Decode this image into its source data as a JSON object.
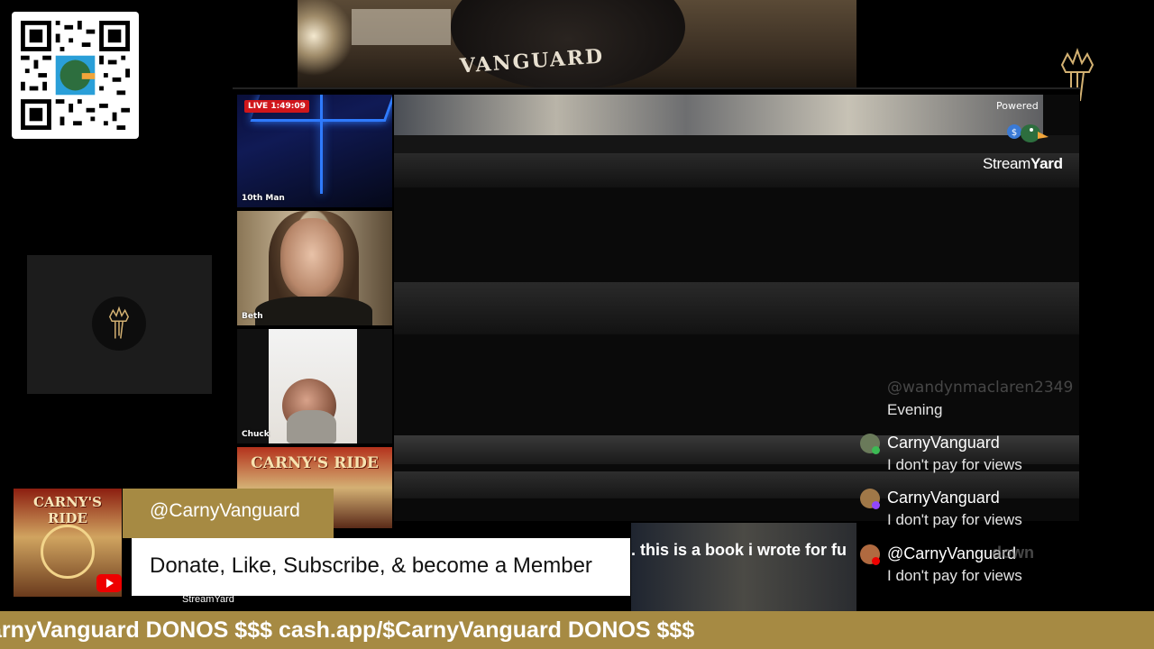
{
  "background": {
    "patch_text": "VANGUARD"
  },
  "stream": {
    "live_badge": "LIVE 1:49:09",
    "participants": [
      {
        "name": "10th Man"
      },
      {
        "name": "Beth"
      },
      {
        "name": "Chuck"
      }
    ],
    "banner_title": "CARNY'S RIDE"
  },
  "branding": {
    "powered_label": "Powered",
    "streamyard_prefix": "Stream",
    "streamyard_suffix": "Yard",
    "streamyard_small": "StreamYard",
    "lower_third_logo": "CARNY'S RIDE"
  },
  "chat": {
    "faded_user": "@wandynmaclaren2349",
    "messages": [
      {
        "name": "",
        "text": "Evening"
      },
      {
        "name": "CarnyVanguard",
        "text": "I don't pay for views",
        "platform_color": "#3cba54",
        "avatar_color": "#6a7a5a"
      },
      {
        "name": "CarnyVanguard",
        "text": "I don't pay for views",
        "platform_color": "#9146ff",
        "avatar_color": "#a07848"
      },
      {
        "name": "@CarnyVanguard",
        "text": "I don't pay for views",
        "platform_color": "#e00",
        "avatar_color": "#b06a40"
      }
    ]
  },
  "caption": {
    "text": ". this is a book i wrote for fu",
    "trailing": "down"
  },
  "lower_third": {
    "handle": "@CarnyVanguard",
    "message": "Donate, Like, Subscribe, & become a Member"
  },
  "ticker": {
    "text": "arnyVanguard DONOS $$$ cash.app/$CarnyVanguard DONOS $$$"
  },
  "colors": {
    "gold": "#a68a43",
    "live_red": "#d0161b",
    "youtube_red": "#e00"
  }
}
